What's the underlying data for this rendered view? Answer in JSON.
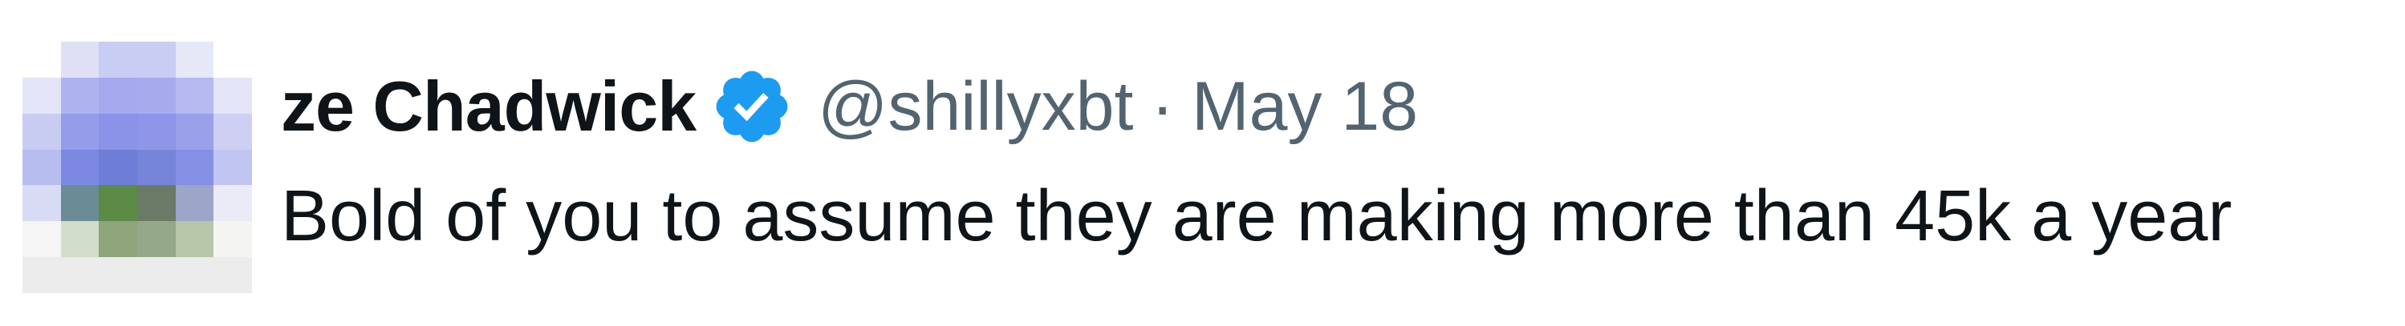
{
  "tweet": {
    "author": {
      "display_name": "ze Chadwick",
      "handle": "@shillyxbt",
      "verified": true,
      "verified_badge_icon": "verified-badge-icon",
      "avatar_icon": "avatar-image-pixelated"
    },
    "separator": "·",
    "timestamp": "May 18",
    "text": "Bold of you to assume they are making more than 45k a year"
  },
  "colors": {
    "text_primary": "#0f1419",
    "text_secondary": "#536471",
    "verified_blue": "#1d9bf0",
    "background": "#ffffff"
  }
}
